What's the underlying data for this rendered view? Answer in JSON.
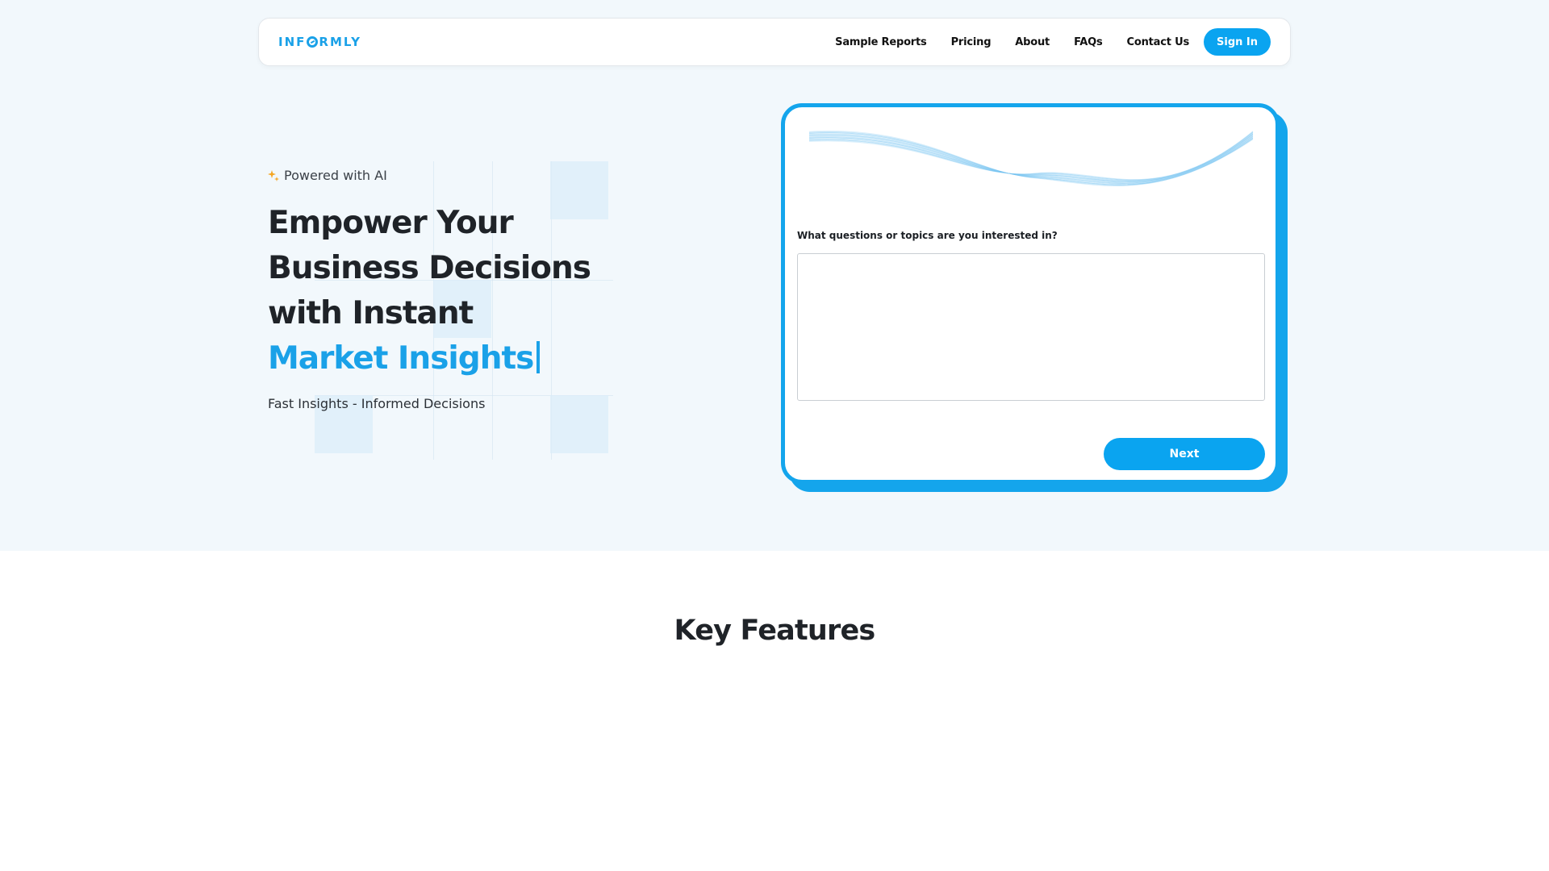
{
  "brand": {
    "logo_prefix": "INF",
    "logo_suffix": "RMLY",
    "accent_color": "#1aa1e8"
  },
  "nav": {
    "links": [
      "Sample Reports",
      "Pricing",
      "About",
      "FAQs",
      "Contact Us"
    ],
    "signin_label": "Sign In"
  },
  "hero": {
    "badge": "Powered with AI",
    "headline_line1": "Empower Your",
    "headline_line2": "Business Decisions",
    "headline_line3": "with Instant",
    "headline_accent": "Market Insights",
    "subline": "Fast Insights - Informed Decisions"
  },
  "form": {
    "question_label": "What questions or topics are you interested in?",
    "input_value": "",
    "input_placeholder": "",
    "next_label": "Next"
  },
  "features": {
    "title": "Key Features"
  },
  "icons": {
    "sparkle": "sparkle-icon",
    "waves": "wave-lines-illustration"
  }
}
